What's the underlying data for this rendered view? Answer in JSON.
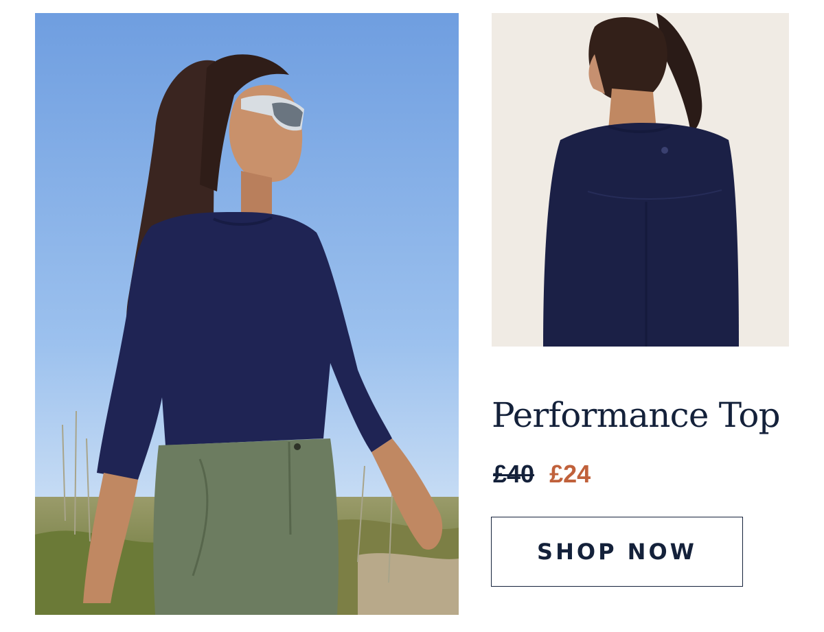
{
  "product": {
    "title": "Performance Top",
    "price_original": "£40",
    "price_sale": "£24",
    "cta_label": "SHOP NOW"
  },
  "colors": {
    "navy": "#14213a",
    "sale": "#c0613b",
    "garment": "#1f2454",
    "sky": "#8cb6e8",
    "backdrop": "#f0ebe4"
  },
  "images": {
    "main": "lifestyle-photo-woman-hiking",
    "back": "product-photo-back-view"
  }
}
